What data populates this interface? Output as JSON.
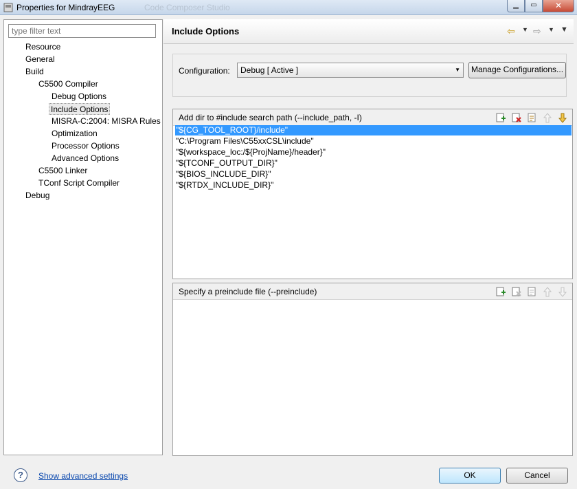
{
  "window": {
    "title": "Properties for MindrayEEG",
    "ghost_title": "Code Composer Studio",
    "min_glyph": "▁",
    "max_glyph": "▭",
    "close_glyph": "✕"
  },
  "filter": {
    "placeholder": "type filter text"
  },
  "tree": [
    {
      "label": "Resource",
      "indent": 0
    },
    {
      "label": "General",
      "indent": 0
    },
    {
      "label": "Build",
      "indent": 0
    },
    {
      "label": "C5500 Compiler",
      "indent": 1
    },
    {
      "label": "Debug Options",
      "indent": 2
    },
    {
      "label": "Include Options",
      "indent": 2,
      "selected": true
    },
    {
      "label": "MISRA-C:2004: MISRA Rules",
      "indent": 2
    },
    {
      "label": "Optimization",
      "indent": 2
    },
    {
      "label": "Processor Options",
      "indent": 2
    },
    {
      "label": "Advanced Options",
      "indent": 2
    },
    {
      "label": "C5500 Linker",
      "indent": 1
    },
    {
      "label": "TConf Script Compiler",
      "indent": 1
    },
    {
      "label": "Debug",
      "indent": 0
    }
  ],
  "page": {
    "title": "Include Options",
    "back_icon": "⇦",
    "forward_icon": "⇨",
    "dropdown_glyph": "▼"
  },
  "configuration": {
    "label": "Configuration:",
    "value": "Debug  [ Active ]",
    "manage_label": "Manage Configurations..."
  },
  "include_paths": {
    "title": "Add dir to #include search path (--include_path, -I)",
    "items": [
      "\"${CG_TOOL_ROOT}/include\"",
      "\"C:\\Program Files\\C55xxCSL\\include\"",
      "\"${workspace_loc:/${ProjName}/header}\"",
      "\"${TCONF_OUTPUT_DIR}\"",
      "\"${BIOS_INCLUDE_DIR}\"",
      "\"${RTDX_INCLUDE_DIR}\""
    ],
    "selected_index": 0
  },
  "preinclude": {
    "title": "Specify a preinclude file (--preinclude)",
    "items": []
  },
  "toolbar_icons": [
    "add-icon",
    "delete-icon",
    "edit-icon",
    "move-up-icon",
    "move-down-icon"
  ],
  "footer": {
    "help_glyph": "?",
    "advanced_link": "Show advanced settings",
    "ok_label": "OK",
    "cancel_label": "Cancel"
  },
  "colors": {
    "selection": "#3399ff",
    "link": "#0645ad",
    "delete_icon": "#d02020",
    "add_icon": "#2a8a2a"
  }
}
